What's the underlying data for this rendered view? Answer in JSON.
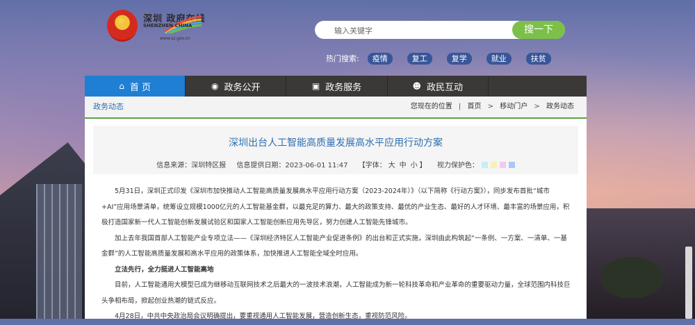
{
  "brand": {
    "name_cn": "深圳 政府在线",
    "name_en": "SHENZHEN CHINA",
    "url": "www.sz.gov.cn"
  },
  "search": {
    "placeholder": "输入关键字",
    "button_label": "搜一下"
  },
  "hot_search": {
    "label": "热门搜索:",
    "tags": [
      "疫情",
      "复工",
      "复学",
      "就业",
      "扶贫"
    ]
  },
  "nav": {
    "items": [
      {
        "label": "首 页",
        "icon": "home-icon"
      },
      {
        "label": "政务公开",
        "icon": "eye-icon"
      },
      {
        "label": "政务服务",
        "icon": "service-icon"
      },
      {
        "label": "政民互动",
        "icon": "people-icon"
      }
    ]
  },
  "breadcrumb": {
    "section_title": "政务动态",
    "location_label": "您现在的位置",
    "items": [
      "首页",
      "移动门户",
      "政务动态"
    ],
    "separator": ">"
  },
  "article": {
    "title": "深圳出台人工智能高质量发展高水平应用行动方案",
    "source": "信息来源：深圳特区报",
    "date": "信息提供日期：2023-06-01 11:47",
    "font_size_label": "【字体：",
    "font_sizes": [
      "大",
      "中",
      "小"
    ],
    "font_size_end": "】",
    "eye_protect_label": "视力保护色：",
    "eye_colors": [
      "#c9ecf6",
      "#f7f2b3",
      "#f2c8f0",
      "#a9c8f3"
    ],
    "paragraphs": [
      "5月31日，深圳正式印发《深圳市加快推动人工智能高质量发展高水平应用行动方案（2023-2024年）》（以下简称《行动方案》），同步发布首批“城市+AI”应用场景清单，统筹设立规模1000亿元的人工智能基金群，以最充足的算力、最大的政策支持、最优的产业生态、最好的人才环境、最丰富的场景应用，积极打造国家新一代人工智能创新发展试验区和国家人工智能创新应用先导区，努力创建人工智能先锋城市。",
      "加上去年我国首部人工智能产业专项立法——《深圳经济特区人工智能产业促进条例》的出台和正式实施，深圳由此构筑起“一条例、一方案、一清单、一基金群”的人工智能高质量发展和高水平应用的政策体系，加快推进人工智能全域全时应用。",
      "立法先行，全力挺进人工智能高地",
      "目前，人工智能通用大模型已成为继移动互联网技术之后最大的一波技术浪潮，人工智能成为新一轮科技革命和产业革命的重要驱动力量，全球范围内科技巨头争相布局，掀起创业热潮的链式反应。",
      "4月28日，中共中央政治局会议明确提出，要重视通用人工智能发展，营造创新生态，重视防范风险。"
    ]
  }
}
